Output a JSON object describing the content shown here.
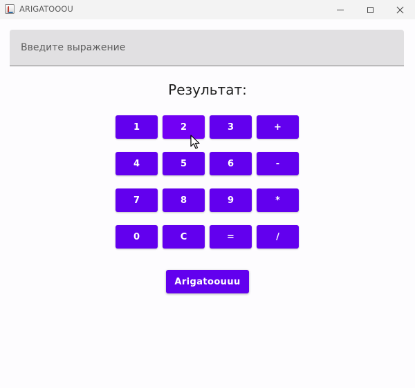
{
  "window": {
    "title": "ARIGATOOOU",
    "controls": [
      "minimize",
      "maximize",
      "close"
    ]
  },
  "expression_input": {
    "placeholder": "Введите выражение",
    "value": ""
  },
  "result": {
    "label": "Результат:"
  },
  "keypad": {
    "hovered_key": "2",
    "rows": [
      [
        "1",
        "2",
        "3",
        "+"
      ],
      [
        "4",
        "5",
        "6",
        "-"
      ],
      [
        "7",
        "8",
        "9",
        "*"
      ],
      [
        "0",
        "C",
        "=",
        "/"
      ]
    ]
  },
  "thanks_button": {
    "label": "Arigatoouuu"
  },
  "colors": {
    "accent": "#6200ee",
    "accent_hover": "#7200f4",
    "input_background": "#e1e0e2",
    "window_background": "#fdfcfe"
  }
}
